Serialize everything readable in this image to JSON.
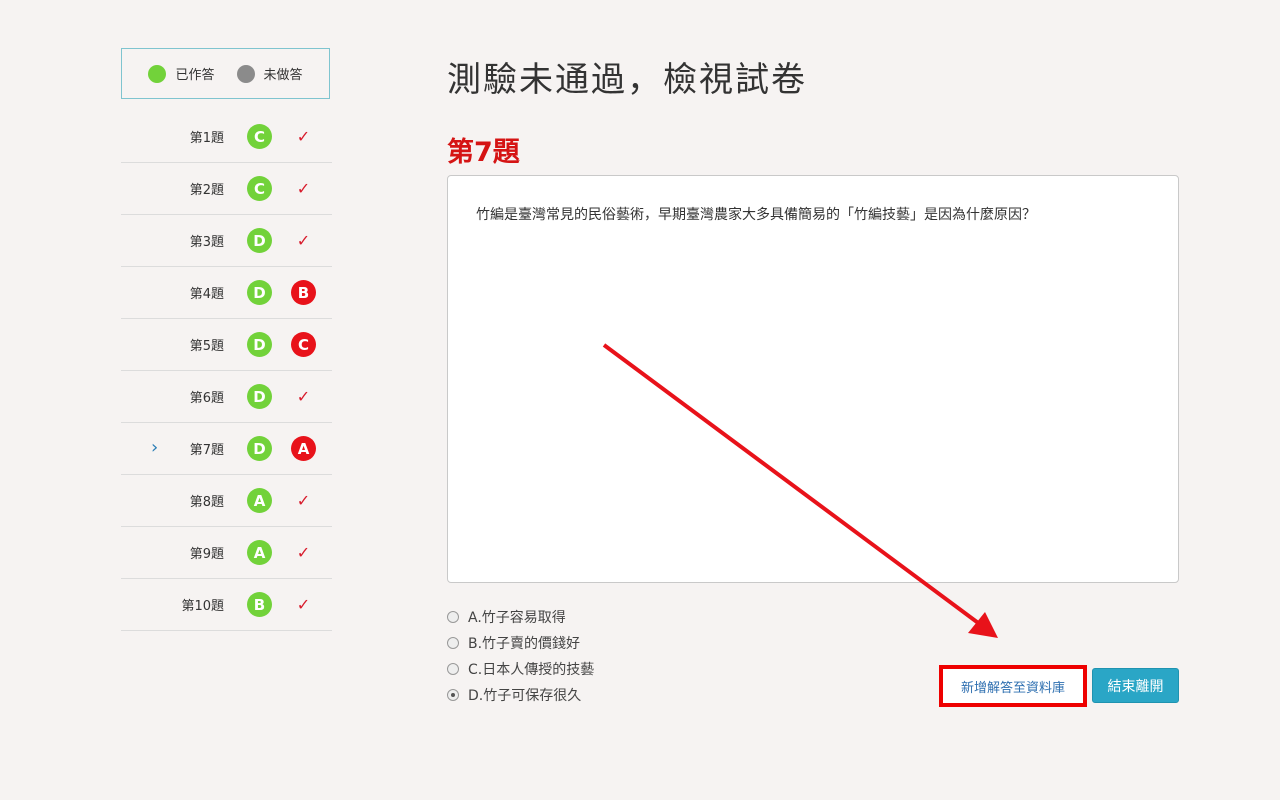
{
  "legend": {
    "answered": "已作答",
    "unanswered": "未做答"
  },
  "questions": [
    {
      "label": "第1題",
      "answer": "C",
      "result": "✓",
      "correct": true
    },
    {
      "label": "第2題",
      "answer": "C",
      "result": "✓",
      "correct": true
    },
    {
      "label": "第3題",
      "answer": "D",
      "result": "✓",
      "correct": true
    },
    {
      "label": "第4題",
      "answer": "D",
      "result": "B",
      "correct": false
    },
    {
      "label": "第5題",
      "answer": "D",
      "result": "C",
      "correct": false
    },
    {
      "label": "第6題",
      "answer": "D",
      "result": "✓",
      "correct": true
    },
    {
      "label": "第7題",
      "answer": "D",
      "result": "A",
      "correct": false,
      "current": true
    },
    {
      "label": "第8題",
      "answer": "A",
      "result": "✓",
      "correct": true
    },
    {
      "label": "第9題",
      "answer": "A",
      "result": "✓",
      "correct": true
    },
    {
      "label": "第10題",
      "answer": "B",
      "result": "✓",
      "correct": true
    }
  ],
  "main": {
    "title": "測驗未通過，檢視試卷",
    "question_number": "第7題",
    "question_text": "竹編是臺灣常見的民俗藝術，早期臺灣農家大多具備簡易的「竹編技藝」是因為什麼原因？",
    "options": [
      {
        "label": "A.竹子容易取得",
        "checked": false
      },
      {
        "label": "B.竹子賣的價錢好",
        "checked": false
      },
      {
        "label": "C.日本人傳授的技藝",
        "checked": false
      },
      {
        "label": "D.竹子可保存很久",
        "checked": true
      }
    ],
    "add_button": "新增解答至資料庫",
    "exit_button": "結束離開"
  },
  "colors": {
    "answered": "#72d23a",
    "unanswered": "#8b8b8b",
    "wrong": "#e8121a",
    "accent": "#2aa6c6",
    "title_red": "#d51414"
  }
}
